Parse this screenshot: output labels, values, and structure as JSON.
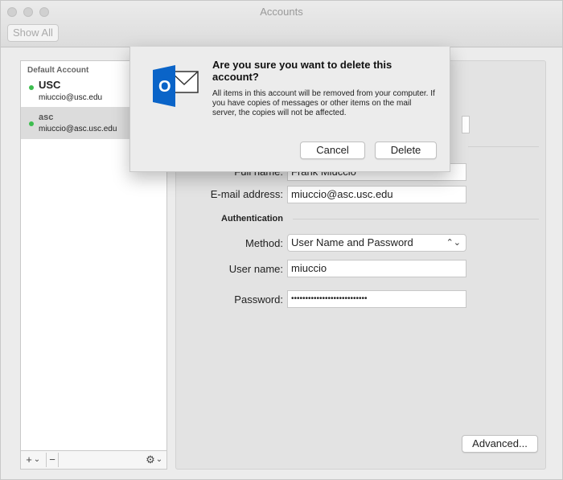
{
  "window": {
    "title": "Accounts",
    "show_all": "Show All"
  },
  "sidebar": {
    "group_title": "Default Account",
    "accounts": [
      {
        "name": "USC",
        "email": "miuccio@usc.edu",
        "selected": false
      },
      {
        "name": "asc",
        "email": "miuccio@asc.usc.edu",
        "selected": true
      }
    ],
    "toolbar": {
      "add": "+",
      "add_menu": "⌄",
      "remove": "−",
      "gear": "⚙",
      "gear_menu": "⌄"
    }
  },
  "account_panel": {
    "full_name_label": "Full name:",
    "full_name_value": "Frank Miuccio",
    "email_label": "E-mail address:",
    "email_value": "miuccio@asc.usc.edu",
    "authentication_title": "Authentication",
    "method_label": "Method:",
    "method_value": "User Name and Password",
    "username_label": "User name:",
    "username_value": "miuccio",
    "password_label": "Password:",
    "password_value": "•••••••••••••••••••••••••••",
    "advanced_button": "Advanced..."
  },
  "dialog": {
    "title": "Are you sure you want to delete this account?",
    "message": "All items in this account will be removed from your computer. If you have copies of messages or other items on the mail server, the copies will not be affected.",
    "cancel_button": "Cancel",
    "delete_button": "Delete",
    "logo_letter": "O",
    "colors": {
      "outlook_blue": "#0a64c8",
      "status_green": "#3dbd4f"
    }
  }
}
